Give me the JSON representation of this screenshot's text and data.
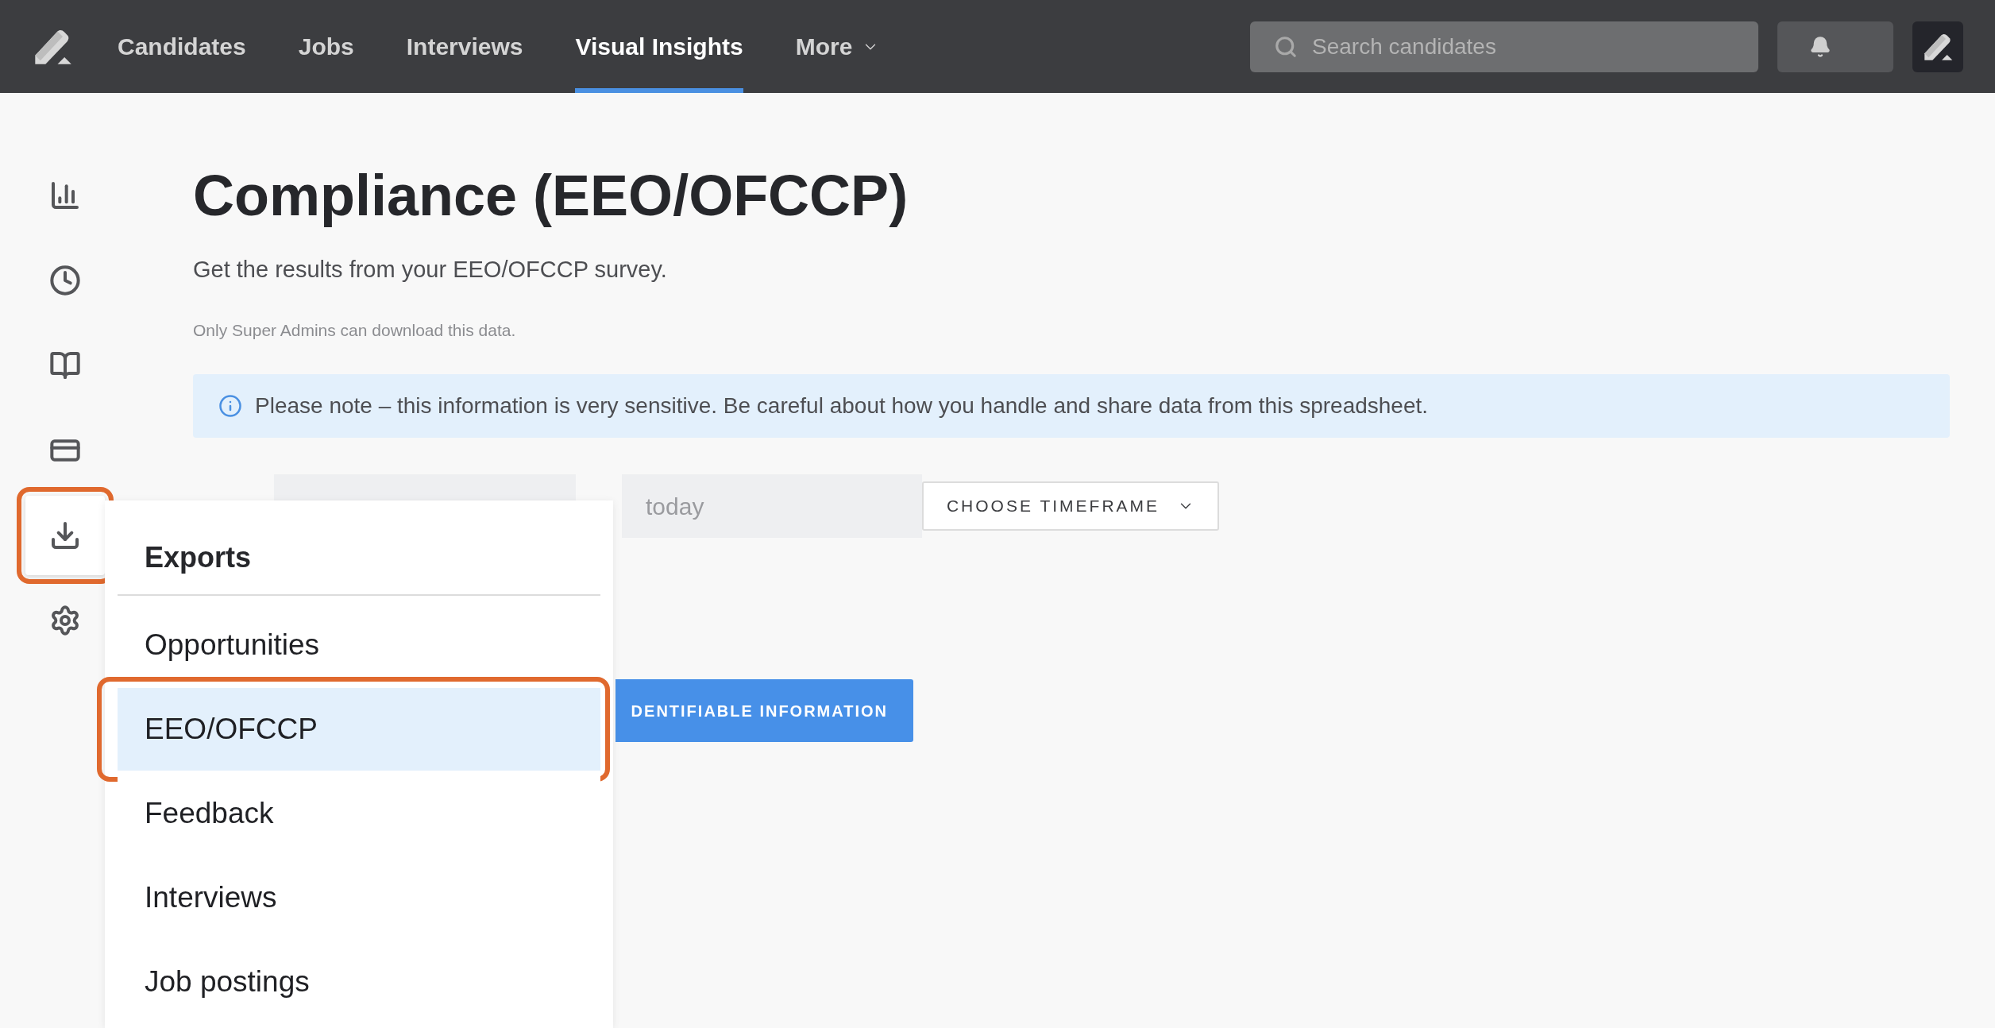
{
  "nav": {
    "items": [
      {
        "label": "Candidates",
        "selected": false,
        "kind": "link"
      },
      {
        "label": "Jobs",
        "selected": false,
        "kind": "link"
      },
      {
        "label": "Interviews",
        "selected": false,
        "kind": "link"
      },
      {
        "label": "Visual Insights",
        "selected": true,
        "kind": "link"
      },
      {
        "label": "More",
        "selected": false,
        "kind": "dropdown"
      }
    ]
  },
  "search": {
    "placeholder": "Search candidates"
  },
  "sidebar": {
    "items": [
      {
        "kind": "chart",
        "selected": false
      },
      {
        "kind": "clock",
        "selected": false
      },
      {
        "kind": "book",
        "selected": false
      },
      {
        "kind": "card",
        "selected": false
      },
      {
        "kind": "download",
        "selected": true
      },
      {
        "kind": "settings",
        "selected": false
      }
    ]
  },
  "page": {
    "title": "Compliance (EEO/OFCCP)",
    "subtitle": "Get the results from your EEO/OFCCP survey.",
    "note": "Only Super Admins can download this data."
  },
  "notice": {
    "text": "Please note – this information is very sensitive. Be careful about how you handle and share data from this spreadsheet."
  },
  "form": {
    "to_field": {
      "value": "today"
    },
    "timeframe_button": "CHOOSE TIMEFRAME",
    "download_button": "DENTIFIABLE INFORMATION"
  },
  "exports_menu": {
    "title": "Exports",
    "items": [
      {
        "label": "Opportunities",
        "selected": false
      },
      {
        "label": "EEO/OFCCP",
        "selected": true
      },
      {
        "label": "Feedback",
        "selected": false
      },
      {
        "label": "Interviews",
        "selected": false
      },
      {
        "label": "Job postings",
        "selected": false
      }
    ]
  }
}
